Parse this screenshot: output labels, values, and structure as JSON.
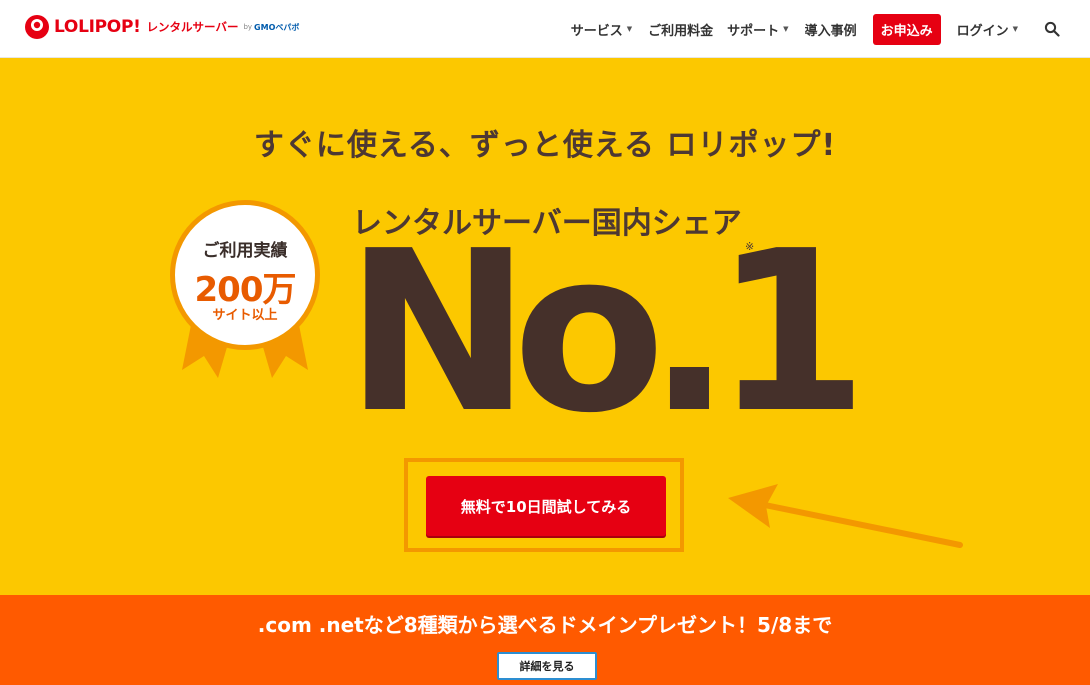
{
  "header": {
    "logo_text": "LOLIPOP!",
    "logo_sub": "レンタルサーバー",
    "logo_by": "by",
    "logo_gmo": "GMOペパボ",
    "nav": [
      {
        "label": "サービス",
        "dropdown": true
      },
      {
        "label": "ご利用料金",
        "dropdown": false
      },
      {
        "label": "サポート",
        "dropdown": true
      },
      {
        "label": "導入事例",
        "dropdown": false
      }
    ],
    "apply_label": "お申込み",
    "login_label": "ログイン",
    "search_icon": "search-icon"
  },
  "hero": {
    "tagline": "すぐに使える、ずっと使える ロリポップ!",
    "share_label": "レンタルサーバー国内シェア",
    "big_text": "No.1",
    "note_mark": "※",
    "badge": {
      "line1": "ご利用実績",
      "line2": "200万",
      "line3": "サイト以上"
    },
    "cta_label": "無料で10日間試してみる"
  },
  "campaign": {
    "text": ".com .netなど8種類から選べるドメインプレゼント！5/8まで",
    "button_label": "詳細を見る"
  },
  "colors": {
    "brand_red": "#e60012",
    "hero_yellow": "#fcc800",
    "accent_orange": "#f39800",
    "campaign_orange": "#ff5a00",
    "text_brown": "#45302a"
  }
}
